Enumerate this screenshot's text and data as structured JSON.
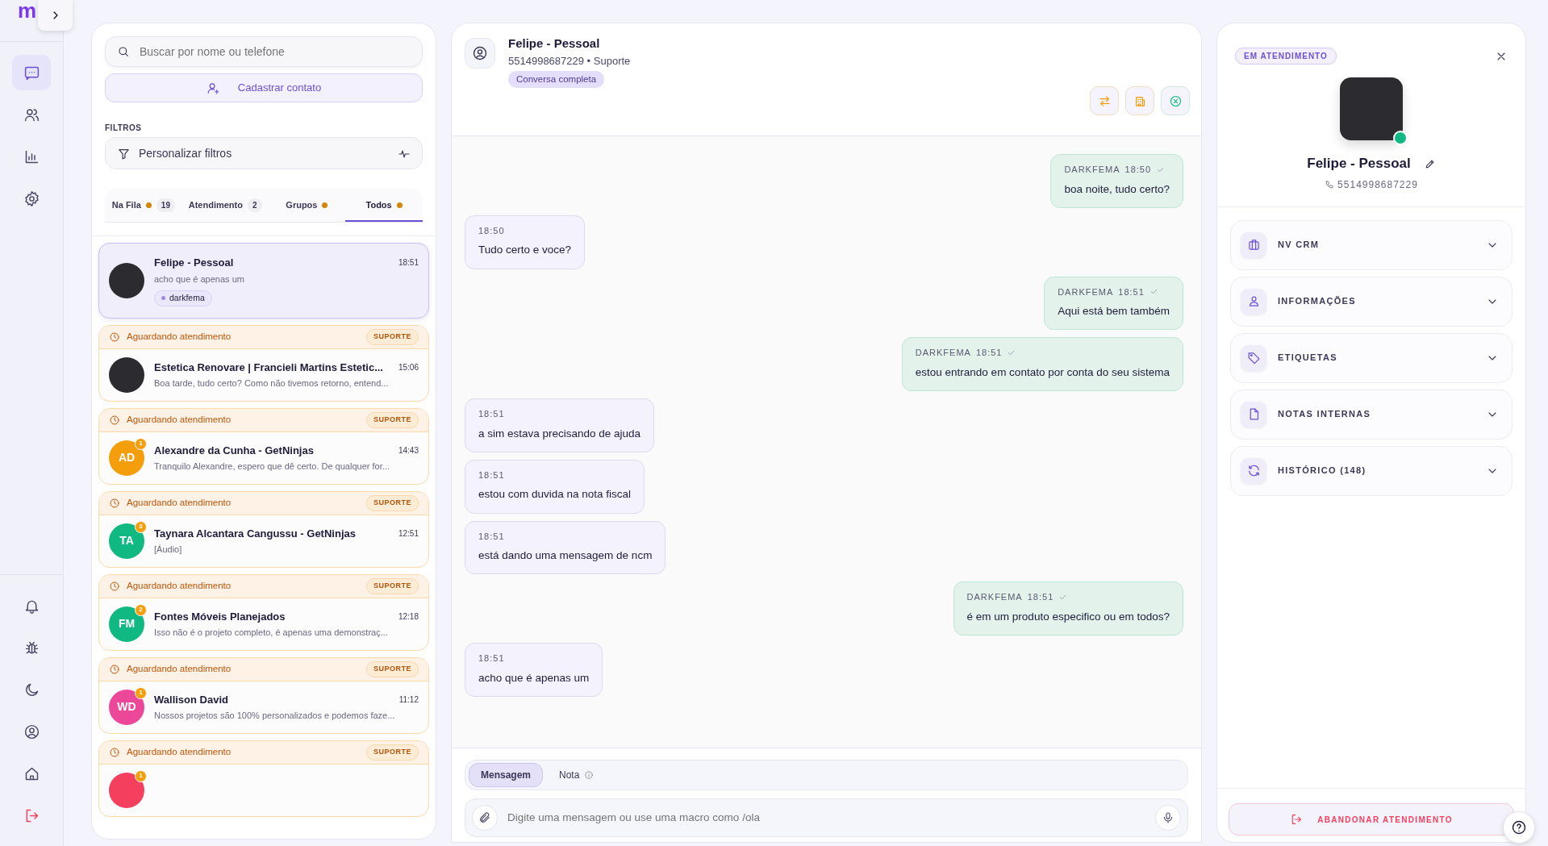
{
  "rail": {
    "logo": "m",
    "top_items": [
      {
        "kind": "chat",
        "selected": true
      },
      {
        "kind": "users",
        "selected": false
      },
      {
        "kind": "chart",
        "selected": false
      },
      {
        "kind": "gear",
        "selected": false
      }
    ],
    "bottom_items": [
      {
        "kind": "bell"
      },
      {
        "kind": "bug"
      },
      {
        "kind": "moon"
      },
      {
        "kind": "user-circle"
      },
      {
        "kind": "home"
      },
      {
        "kind": "logout"
      }
    ]
  },
  "contacts_panel": {
    "search": {
      "placeholder": "Buscar por nome ou telefone"
    },
    "add_button": "Cadastrar contato",
    "filters_label": "FILTROS",
    "filters_button": "Personalizar filtros",
    "tabs": [
      {
        "label": "Na Fila",
        "dot": true,
        "count": "19",
        "selected": false
      },
      {
        "label": "Atendimento",
        "dot": false,
        "count": "2",
        "selected": false
      },
      {
        "label": "Grupos",
        "dot": true,
        "selected": false
      },
      {
        "label": "Todos",
        "dot": true,
        "selected": true
      }
    ],
    "contacts": [
      {
        "kind": "active",
        "selected": true,
        "avatar": {
          "kind": "photo"
        },
        "name": "Felipe - Pessoal",
        "time": "18:51",
        "preview": "acho que é apenas um",
        "tag": "darkfema"
      },
      {
        "kind": "waiting",
        "selected": false,
        "status": "Aguardando atendimento",
        "queue": "SUPORTE",
        "avatar": {
          "kind": "photo"
        },
        "name": "Estetica Renovare | Francieli Martins Estetic...",
        "time": "15:06",
        "preview": "Boa tarde, tudo certo? Como não tivemos retorno, entend..."
      },
      {
        "kind": "waiting",
        "selected": false,
        "status": "Aguardando atendimento",
        "queue": "SUPORTE",
        "avatar": {
          "kind": "initials",
          "initials": "AD",
          "color": "#f59e0b"
        },
        "unread": "1",
        "name": "Alexandre da Cunha - GetNinjas",
        "time": "14:43",
        "preview": "Tranquilo Alexandre, espero que dê certo. De qualquer for..."
      },
      {
        "kind": "waiting",
        "selected": false,
        "status": "Aguardando atendimento",
        "queue": "SUPORTE",
        "avatar": {
          "kind": "initials",
          "initials": "TA",
          "color": "#10b981"
        },
        "unread": "3",
        "name": "Taynara Alcantara Cangussu - GetNinjas",
        "time": "12:51",
        "preview": "[Áudio]"
      },
      {
        "kind": "waiting",
        "selected": false,
        "status": "Aguardando atendimento",
        "queue": "SUPORTE",
        "avatar": {
          "kind": "initials",
          "initials": "FM",
          "color": "#10b981"
        },
        "unread": "2",
        "name": "Fontes Móveis Planejados",
        "time": "12:18",
        "preview": "Isso não é o projeto completo, é apenas uma demonstraç..."
      },
      {
        "kind": "waiting",
        "selected": false,
        "status": "Aguardando atendimento",
        "queue": "SUPORTE",
        "avatar": {
          "kind": "initials",
          "initials": "WD",
          "color": "#ec4899"
        },
        "unread": "1",
        "name": "Wallison David",
        "time": "11:12",
        "preview": "Nossos projetos são 100% personalizados e podemos faze..."
      },
      {
        "kind": "waiting",
        "selected": false,
        "status": "Aguardando atendimento",
        "queue": "SUPORTE",
        "avatar": {
          "kind": "initials",
          "color": "#f43f5e"
        },
        "unread": "1"
      }
    ]
  },
  "chat": {
    "title": "Felipe - Pessoal",
    "subtitle": "5514998687229 • Suporte",
    "badge": "Conversa completa",
    "header_actions": [
      {
        "kind": "transfer"
      },
      {
        "kind": "building"
      },
      {
        "kind": "close-circle"
      }
    ],
    "messages": [
      {
        "kind": "out",
        "sender": "DARKFEMA",
        "time": "18:50",
        "text": "boa noite, tudo certo?"
      },
      {
        "kind": "in",
        "time": "18:50",
        "text": "Tudo certo e voce?"
      },
      {
        "kind": "out",
        "sender": "DARKFEMA",
        "time": "18:51",
        "text": "Aqui está bem também"
      },
      {
        "kind": "out",
        "sender": "DARKFEMA",
        "time": "18:51",
        "text": "estou entrando em contato por conta do seu sistema"
      },
      {
        "kind": "in",
        "time": "18:51",
        "text": "a sim estava precisando de ajuda"
      },
      {
        "kind": "in",
        "time": "18:51",
        "text": "estou com duvida na nota fiscal"
      },
      {
        "kind": "in",
        "time": "18:51",
        "text": "está dando uma mensagem de ncm"
      },
      {
        "kind": "out",
        "sender": "DARKFEMA",
        "time": "18:51",
        "text": "é em um produto especifico ou em todos?"
      },
      {
        "kind": "in",
        "time": "18:51",
        "text": "acho que é apenas um"
      }
    ],
    "compose_modes": [
      {
        "label": "Mensagem",
        "selected": true,
        "info": false
      },
      {
        "label": "Nota",
        "selected": false,
        "info": true
      }
    ],
    "composer": {
      "placeholder": "Digite uma mensagem ou use uma macro como /ola"
    }
  },
  "details": {
    "status_badge": "EM ATENDIMENTO",
    "online": true,
    "name": "Felipe - Pessoal",
    "phone": "5514998687229",
    "sections": [
      {
        "kind": "briefcase",
        "label": "NV CRM",
        "expanded": false
      },
      {
        "kind": "user",
        "label": "INFORMAÇÕES",
        "expanded": false
      },
      {
        "kind": "tag",
        "label": "ETIQUETAS",
        "expanded": false
      },
      {
        "kind": "file",
        "label": "NOTAS INTERNAS",
        "expanded": false
      },
      {
        "kind": "refresh",
        "label": "HISTÓRICO (148)",
        "expanded": false
      }
    ],
    "leave_button": "ABANDONAR ATENDIMENTO"
  }
}
